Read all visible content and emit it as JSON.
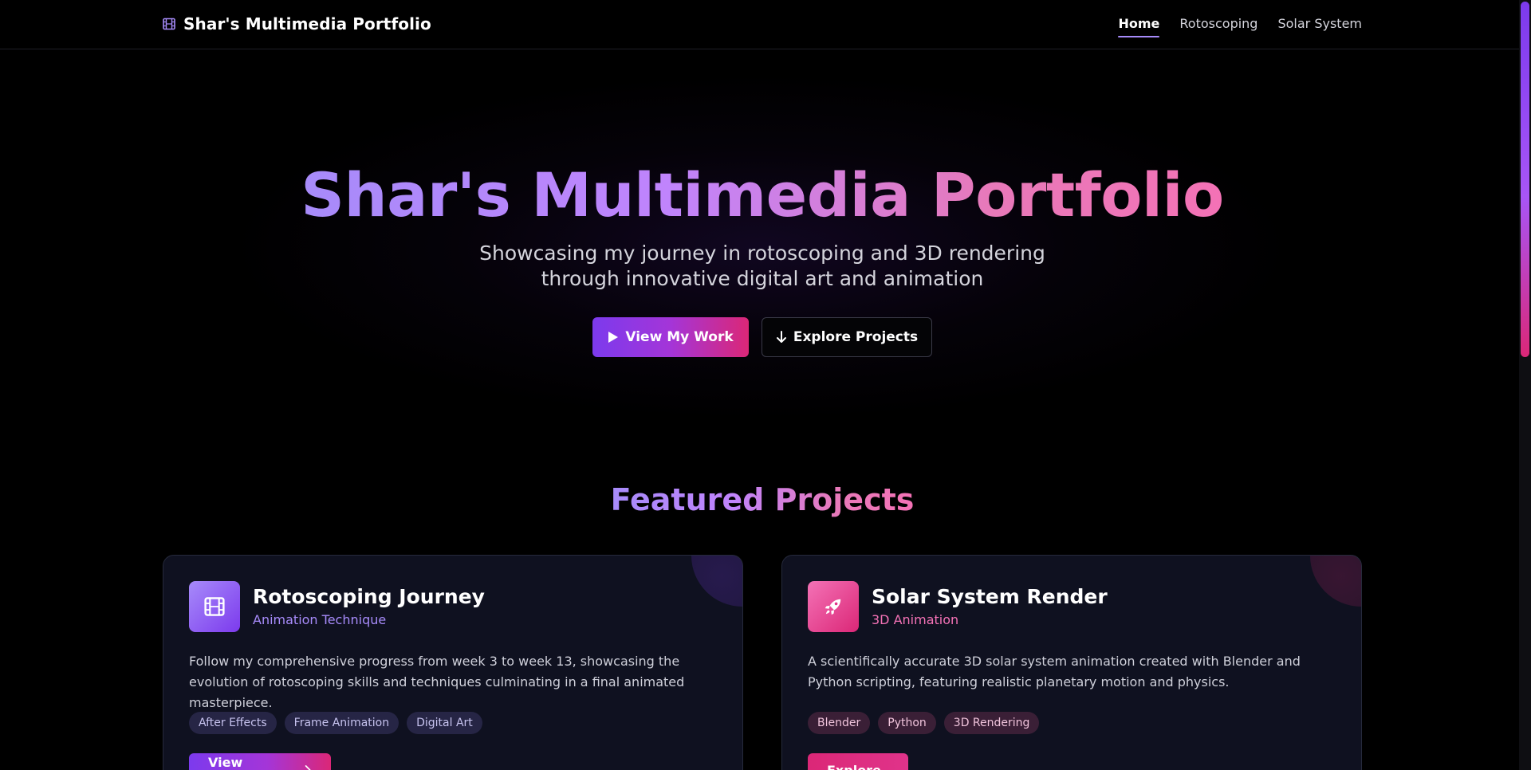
{
  "nav": {
    "brand_icon": "film-icon",
    "brand": "Shar's Multimedia Portfolio",
    "links": [
      {
        "label": "Home",
        "active": true
      },
      {
        "label": "Rotoscoping",
        "active": false
      },
      {
        "label": "Solar System",
        "active": false
      }
    ]
  },
  "hero": {
    "title": "Shar's Multimedia Portfolio",
    "subtitle": "Showcasing my journey in rotoscoping and 3D rendering through innovative digital art and animation",
    "primary_button": {
      "icon": "play-icon",
      "label": "View My Work"
    },
    "secondary_button": {
      "icon": "arrow-down-icon",
      "label": "Explore Projects"
    }
  },
  "featured": {
    "title": "Featured Projects",
    "projects": [
      {
        "icon": "film-icon",
        "title": "Rotoscoping Journey",
        "category": "Animation Technique",
        "description": "Follow my comprehensive progress from week 3 to week 13, showcasing the evolution of rotoscoping skills and techniques culminating in a final animated masterpiece.",
        "tags": [
          "After Effects",
          "Frame Animation",
          "Digital Art"
        ],
        "button": {
          "label": "View Progress",
          "icon": "arrow-right-icon"
        }
      },
      {
        "icon": "rocket-icon",
        "title": "Solar System Render",
        "category": "3D Animation",
        "description": "A scientifically accurate 3D solar system animation created with Blender and Python scripting, featuring realistic planetary motion and physics.",
        "tags": [
          "Blender",
          "Python",
          "3D Rendering"
        ],
        "button": {
          "label": "Explore",
          "icon": "arrow-right-icon"
        }
      }
    ]
  },
  "colors": {
    "accent_purple": "#a78bfa",
    "accent_violet": "#7c3aed",
    "accent_pink": "#f472b6",
    "accent_magenta": "#db2777",
    "background": "#000000",
    "card_background": "#0f1120"
  }
}
